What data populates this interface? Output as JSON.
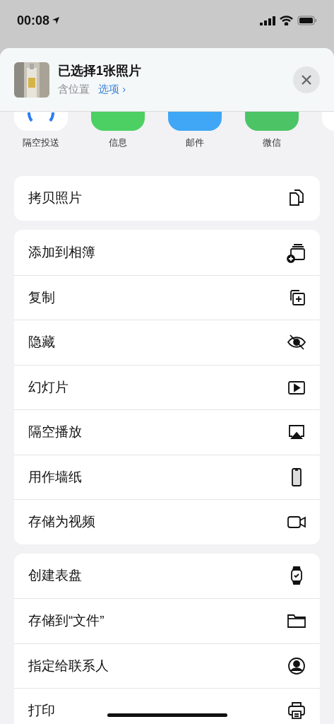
{
  "status_bar": {
    "time": "00:08"
  },
  "header": {
    "title": "已选择1张照片",
    "subtitle": "含位置",
    "options_link": "选项 ›"
  },
  "apps": [
    {
      "kind": "airdrop",
      "label": "隔空投送"
    },
    {
      "kind": "messages",
      "label": "信息"
    },
    {
      "kind": "mail",
      "label": "邮件"
    },
    {
      "kind": "wechat",
      "label": "微信"
    },
    {
      "kind": "partial"
    }
  ],
  "action_groups": [
    [
      {
        "label": "拷贝照片",
        "kind": "copy"
      }
    ],
    [
      {
        "label": "添加到相簿",
        "kind": "album"
      },
      {
        "label": "复制",
        "kind": "duplicate"
      },
      {
        "label": "隐藏",
        "kind": "hide"
      },
      {
        "label": "幻灯片",
        "kind": "slideshow"
      },
      {
        "label": "隔空播放",
        "kind": "airplay"
      },
      {
        "label": "用作墙纸",
        "kind": "wallpaper"
      },
      {
        "label": "存储为视频",
        "kind": "video"
      }
    ],
    [
      {
        "label": "创建表盘",
        "kind": "watch"
      },
      {
        "label": "存储到“文件”",
        "kind": "folder"
      },
      {
        "label": "指定给联系人",
        "kind": "contact"
      },
      {
        "label": "打印",
        "kind": "print"
      }
    ]
  ]
}
